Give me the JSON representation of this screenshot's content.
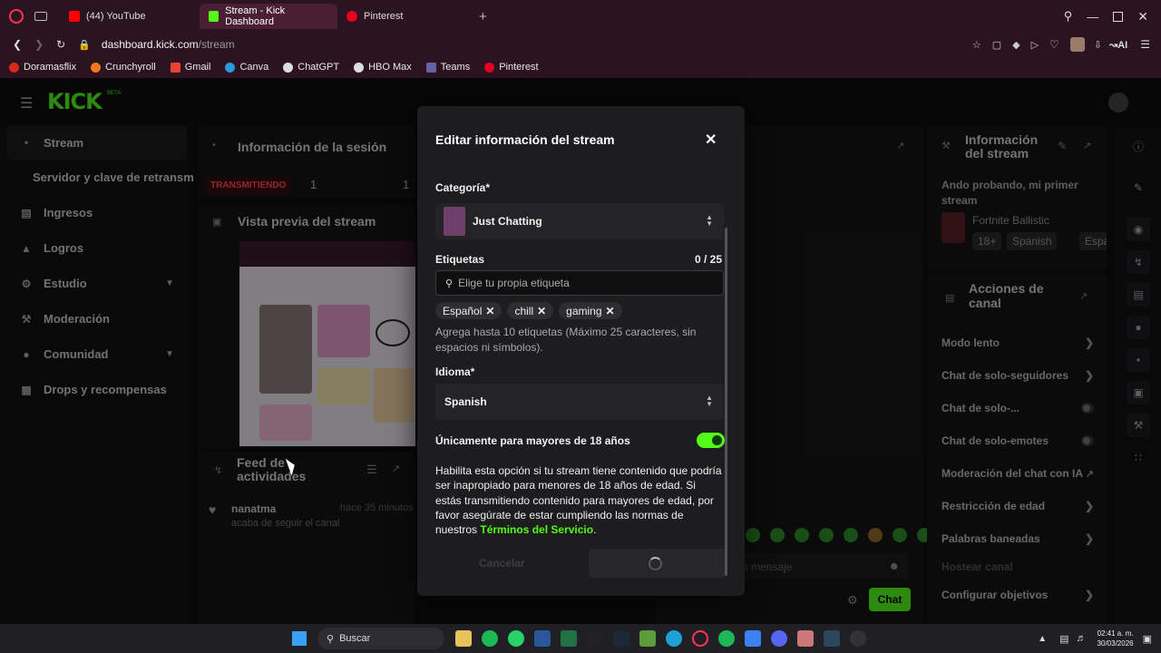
{
  "browser": {
    "tabs": [
      {
        "label": "(44) YouTube",
        "color": "#ff0000"
      },
      {
        "label": "Stream - Kick Dashboard",
        "color": "#53fc18",
        "active": true
      },
      {
        "label": "Pinterest",
        "color": "#e60023"
      }
    ],
    "url_domain": "dashboard.kick.com",
    "url_path": "/stream",
    "ai_label": "AI"
  },
  "bookmarks": [
    {
      "label": "Doramasflix",
      "color": "#d62a1a"
    },
    {
      "label": "Crunchyroll",
      "color": "#f47521"
    },
    {
      "label": "Gmail",
      "color": "#ea4335"
    },
    {
      "label": "Canva",
      "color": "#2a9bd8"
    },
    {
      "label": "ChatGPT",
      "color": "#dddddd"
    },
    {
      "label": "HBO Max",
      "color": "#dddddd"
    },
    {
      "label": "Teams",
      "color": "#6264a7"
    },
    {
      "label": "Pinterest",
      "color": "#e60023"
    }
  ],
  "brand": {
    "logo": "KICK",
    "badge": "BETA",
    "accent": "#53fc18"
  },
  "sidebar": {
    "items": [
      {
        "label": "Stream",
        "icon": "broadcast-icon"
      },
      {
        "label": "Servidor y clave de retransm",
        "icon": ""
      },
      {
        "label": "Ingresos",
        "icon": "wallet-icon"
      },
      {
        "label": "Logros",
        "icon": "trophy-icon"
      },
      {
        "label": "Estudio",
        "icon": "tools-icon"
      },
      {
        "label": "Moderación",
        "icon": "wrench-icon"
      },
      {
        "label": "Comunidad",
        "icon": "people-icon"
      },
      {
        "label": "Drops y recompensas",
        "icon": "gift-icon"
      }
    ]
  },
  "session": {
    "title": "Información de la sesión",
    "status": "TRANSMITIENDO",
    "stat1": "1",
    "stat2": "1"
  },
  "preview": {
    "title": "Vista previa del stream"
  },
  "feed": {
    "title": "Feed de actividades",
    "user": "nanatma",
    "time": "hace 35 minutos",
    "event": "acaba de seguir el canal"
  },
  "stream_info": {
    "title": "Información del stream",
    "stream_title": "Ando probando, mi primer stream",
    "category": "Fortnite Ballistic",
    "tags": [
      "18+",
      "Spanish",
      "Espa"
    ]
  },
  "channel_actions": {
    "title": "Acciones de canal",
    "items": [
      {
        "label": "Modo lento",
        "type": "arrow"
      },
      {
        "label": "Chat de solo-seguidores",
        "type": "arrow"
      },
      {
        "label": "Chat de solo-...",
        "type": "toggle"
      },
      {
        "label": "Chat de solo-emotes",
        "type": "toggle"
      },
      {
        "label": "Moderación del chat con IA",
        "type": "link"
      },
      {
        "label": "Restricción de edad",
        "type": "arrow"
      },
      {
        "label": "Palabras baneadas",
        "type": "arrow"
      },
      {
        "label": "Hostear canal",
        "type": "none"
      },
      {
        "label": "Configurar objetivos",
        "type": "arrow"
      }
    ]
  },
  "chat": {
    "placeholder": "n mensaje",
    "button": "Chat"
  },
  "modal": {
    "title": "Editar información del stream",
    "category_label": "Categoría*",
    "category_value": "Just Chatting",
    "tags_label": "Etiquetas",
    "tags_count": "0 / 25",
    "tags_placeholder": "Elige tu propia etiqueta",
    "tags": [
      "Español",
      "chill",
      "gaming"
    ],
    "tags_help": "Agrega hasta 10 etiquetas (Máximo 25 caracteres, sin espacios ni símbolos).",
    "language_label": "Idioma*",
    "language_value": "Spanish",
    "adult_label": "Únicamente para mayores de 18 años",
    "adult_enabled": true,
    "adult_help": "Habilita esta opción si tu stream tiene contenido que podría ser inapropiado para menores de 18 años de edad. Si estás transmitiendo contenido para mayores de edad, por favor asegúrate de estar cumpliendo las normas de nuestros",
    "terms_link": "Términos del Servicio",
    "terms_after": ".",
    "cancel": "Cancelar"
  },
  "taskbar": {
    "search": "Buscar",
    "time": "02:41 a. m.",
    "date": "30/03/2026"
  }
}
